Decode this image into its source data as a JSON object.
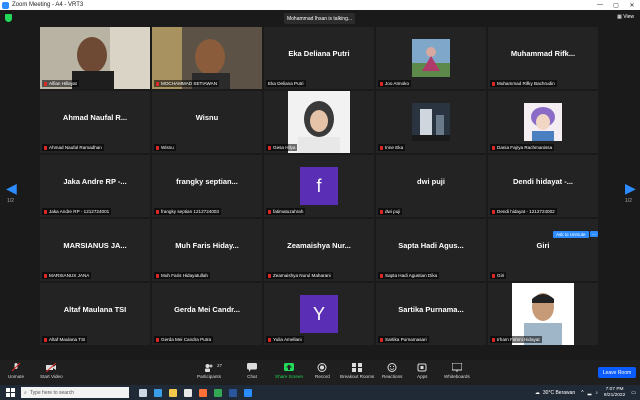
{
  "window": {
    "title": "Zoom Meeting - A4 - VRT3",
    "minimize": "—",
    "maximize": "▢",
    "close": "✕"
  },
  "header": {
    "talking": "Mohammad Ihsan is talking...",
    "view": "View"
  },
  "pager": {
    "left": "1/2",
    "right": "1/2"
  },
  "tiles": [
    {
      "big": "",
      "label": "Alfian Hillayat"
    },
    {
      "big": "",
      "label": "MOCHAMMAD SETIAWAN"
    },
    {
      "big": "Eka Deliana Putri",
      "label": "Eka Deliana Putri"
    },
    {
      "big": "",
      "label": "Joo Atmoko"
    },
    {
      "big": "Muhammad Rifk...",
      "label": "Muhammad Rifky Bachrudin"
    },
    {
      "big": "Ahmad Naufal R...",
      "label": "Ahmad Naufal Ramadhan"
    },
    {
      "big": "Wisnu",
      "label": "Wisnu"
    },
    {
      "big": "",
      "label": "Gesa Hilya"
    },
    {
      "big": "",
      "label": "Inne Eka"
    },
    {
      "big": "",
      "label": "Dania Fajrya Rachmanissa"
    },
    {
      "big": "Jaka Andre RP -...",
      "label": "Jaka Andre RP - 1212724001"
    },
    {
      "big": "frangky septian...",
      "label": "frangky septian 1212724003"
    },
    {
      "big": "",
      "letter": "f",
      "label": "fatimatuzahrah"
    },
    {
      "big": "dwi puji",
      "label": "dwi puji"
    },
    {
      "big": "Dendi hidayat -...",
      "label": "Dendi hidayat - 1212724002"
    },
    {
      "big": "MARSIANUS JA...",
      "label": "MARSIANUS JANA"
    },
    {
      "big": "Muh Faris Hiday...",
      "label": "Muh Faris Hidayatullah"
    },
    {
      "big": "Zeamaishya Nur...",
      "label": "Zeamaishya Nurul Maharani"
    },
    {
      "big": "Sapta Hadi Agus...",
      "label": "Sapta Hadi Agustian Dika"
    },
    {
      "big": "Giri",
      "label": "Giri"
    },
    {
      "big": "Altaf Maulana TSI",
      "label": "Altaf Maulana TSI"
    },
    {
      "big": "Gerda Mei Candr...",
      "label": "Gerda Mei Candra Putra"
    },
    {
      "big": "",
      "letter": "Y",
      "label": "Yulia Amellani"
    },
    {
      "big": "Sartika Purnama...",
      "label": "Sartika Purnamasari"
    },
    {
      "big": "",
      "label": "Irham Fahmi Hidayat"
    }
  ],
  "ask_to_unmute": "Ask to Unmute",
  "more": "...",
  "toolbar": {
    "unmute": "Unmute",
    "start_video": "Start Video",
    "participants": "Participants",
    "participants_count": "27",
    "chat": "Chat",
    "share_screen": "Share Screen",
    "record": "Record",
    "breakout": "Breakout Rooms",
    "reactions": "Reactions",
    "apps": "Apps",
    "whiteboards": "Whiteboards",
    "leave": "Leave Room"
  },
  "taskbar": {
    "search_placeholder": "Type here to search",
    "weather": "30°C  Berawan",
    "time": "7:07 PM",
    "date": "9/21/2022"
  },
  "colors": {
    "accent": "#2d8cff",
    "letter_box": "#5b2fb5",
    "mute_red": "#e02828",
    "share_green": "#23d959"
  }
}
